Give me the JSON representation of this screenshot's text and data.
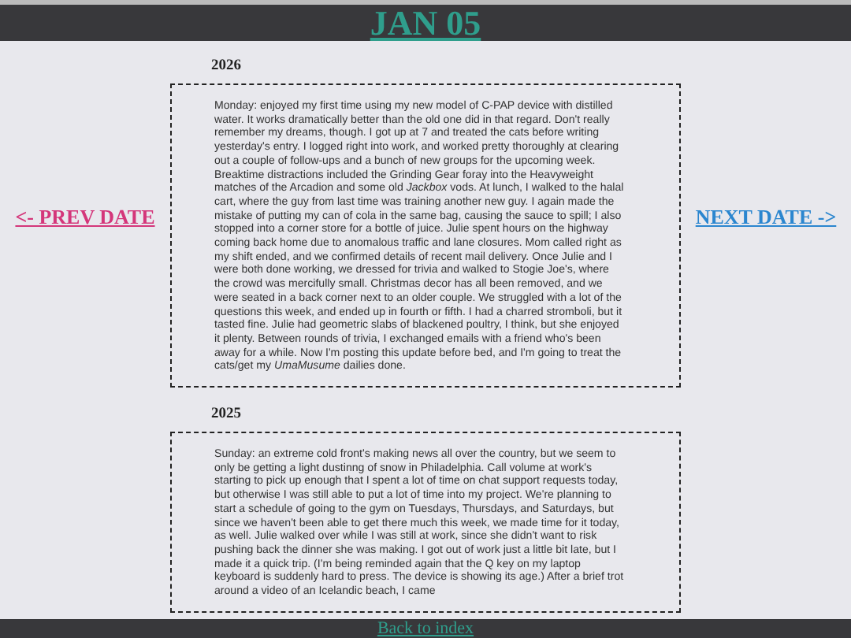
{
  "header": {
    "title": "JAN 05"
  },
  "nav": {
    "prev": "<- PREV DATE",
    "next": "NEXT DATE ->"
  },
  "entries": [
    {
      "year": "2026",
      "text": "Monday: enjoyed my first time using my new model of C-PAP device with distilled water. It works dramatically better than the old one did in that regard. Don't really remember my dreams, though. I got up at 7 and treated the cats before writing yesterday's entry. I logged right into work, and worked pretty thoroughly at clearing out a couple of follow-ups and a bunch of new groups for the upcoming week. Breaktime distractions included the Grinding Gear foray into the Heavyweight matches of the Arcadion and some old *Jackbox* vods. At lunch, I walked to the halal cart, where the guy from last time was training another new guy. I again made the mistake of putting my can of cola in the same bag, causing the sauce to spill; I also stopped into a corner store for a bottle of juice. Julie spent hours on the highway coming back home due to anomalous traffic and lane closures. Mom called right as my shift ended, and we confirmed details of recent mail delivery. Once Julie and I were both done working, we dressed for trivia and walked to Stogie Joe's, where the crowd was mercifully small. Christmas decor has all been removed, and we were seated in a back corner next to an older couple. We struggled with a lot of the questions this week, and ended up in fourth or fifth. I had a charred stromboli, but it tasted fine. Julie had geometric slabs of blackened poultry, I think, but she enjoyed it plenty. Between rounds of trivia, I exchanged emails with a friend who's been away for a while. Now I'm posting this update before bed, and I'm going to treat the cats/get my *UmaMusume* dailies done."
    },
    {
      "year": "2025",
      "text": "Sunday: an extreme cold front's making news all over the country, but we seem to only be getting a light dustinng of snow in Philadelphia. Call volume at work's starting to pick up enough that I spent a lot of time on chat support requests today, but otherwise I was still able to put a lot of time into my project. We're planning to start a schedule of going to the gym on Tuesdays, Thursdays, and Saturdays, but since we haven't been able to get there much this week, we made time for it today, as well. Julie walked over while I was still at work, since she didn't want to risk pushing back the dinner she was making. I got out of work just a little bit late, but I made it a quick trip. (I'm being reminded again that the Q key on my laptop keyboard is suddenly hard to press. The device is showing its age.) After a brief trot around a video of an Icelandic beach, I came"
    }
  ],
  "footer": {
    "link": "Back to index"
  }
}
